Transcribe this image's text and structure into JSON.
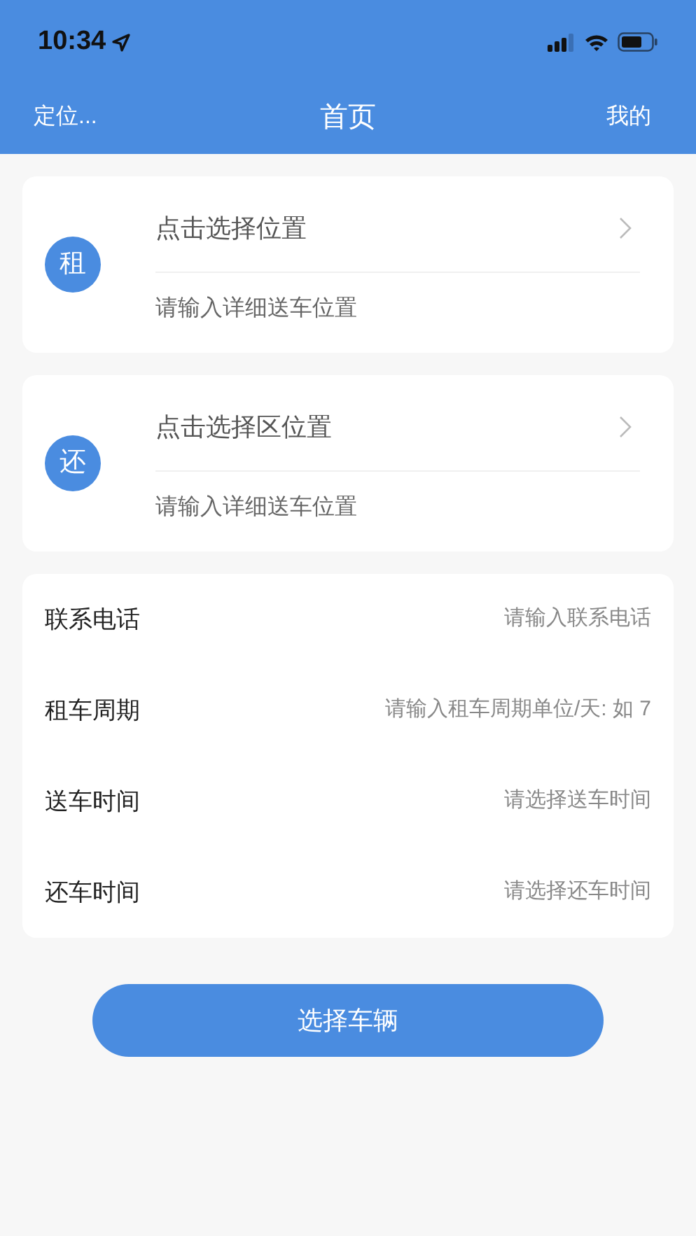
{
  "status_bar": {
    "time": "10:34"
  },
  "nav": {
    "left": "定位...",
    "title": "首页",
    "right": "我的"
  },
  "locations": [
    {
      "badge": "租",
      "select_label": "点击选择位置",
      "placeholder": "请输入详细送车位置"
    },
    {
      "badge": "还",
      "select_label": "点击选择区位置",
      "placeholder": "请输入详细送车位置"
    }
  ],
  "form": [
    {
      "label": "联系电话",
      "placeholder": "请输入联系电话"
    },
    {
      "label": "租车周期",
      "placeholder": "请输入租车周期单位/天: 如 7"
    },
    {
      "label": "送车时间",
      "placeholder": "请选择送车时间"
    },
    {
      "label": "还车时间",
      "placeholder": "请选择还车时间"
    }
  ],
  "submit_button": "选择车辆"
}
